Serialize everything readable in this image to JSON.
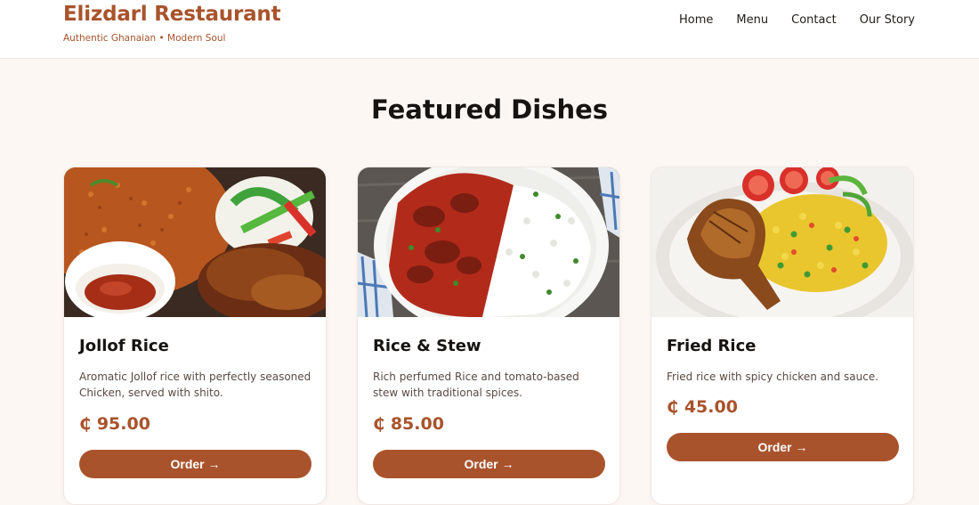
{
  "brand": {
    "title": "Elizdarl Restaurant",
    "tagline": "Authentic Ghanaian • Modern Soul"
  },
  "nav": {
    "items": [
      "Home",
      "Menu",
      "Contact",
      "Our Story"
    ]
  },
  "section": {
    "title": "Featured Dishes"
  },
  "dishes": [
    {
      "name": "Jollof Rice",
      "description": "Aromatic Jollof rice with perfectly seasoned Chicken, served with shito.",
      "price": "₵ 95.00",
      "button": "Order →",
      "image_icon": "jollof-rice-photo"
    },
    {
      "name": "Rice & Stew",
      "description": "Rich perfumed Rice and tomato-based stew with traditional spices.",
      "price": "₵ 85.00",
      "button": "Order →",
      "image_icon": "rice-and-stew-photo"
    },
    {
      "name": "Fried Rice",
      "description": "Fried rice with spicy chicken and sauce.",
      "price": "₵ 45.00",
      "button": "Order →",
      "image_icon": "fried-rice-photo"
    }
  ],
  "colors": {
    "accent": "#a9532c",
    "page_bg": "#fdf7f4"
  }
}
